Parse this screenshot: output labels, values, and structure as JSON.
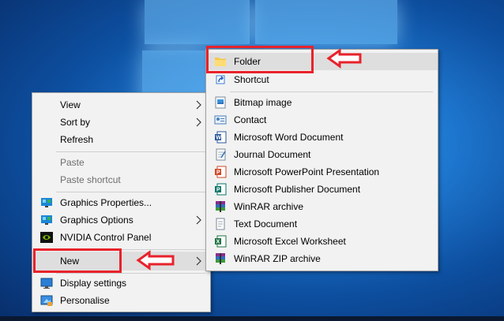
{
  "context_menu": {
    "items": [
      {
        "label": "View"
      },
      {
        "label": "Sort by"
      },
      {
        "label": "Refresh"
      },
      {
        "label": "Paste"
      },
      {
        "label": "Paste shortcut"
      },
      {
        "label": "Graphics Properties..."
      },
      {
        "label": "Graphics Options"
      },
      {
        "label": "NVIDIA Control Panel"
      },
      {
        "label": "New"
      },
      {
        "label": "Display settings"
      },
      {
        "label": "Personalise"
      }
    ]
  },
  "new_submenu": {
    "items": [
      {
        "label": "Folder"
      },
      {
        "label": "Shortcut"
      },
      {
        "label": "Bitmap image"
      },
      {
        "label": "Contact"
      },
      {
        "label": "Microsoft Word Document"
      },
      {
        "label": "Journal Document"
      },
      {
        "label": "Microsoft PowerPoint Presentation"
      },
      {
        "label": "Microsoft Publisher Document"
      },
      {
        "label": "WinRAR archive"
      },
      {
        "label": "Text Document"
      },
      {
        "label": "Microsoft Excel Worksheet"
      },
      {
        "label": "WinRAR ZIP archive"
      }
    ]
  },
  "icons": {
    "folder": "folder-icon",
    "shortcut": "shortcut-arrow-icon",
    "bitmap": "bitmap-image-icon",
    "contact": "contact-card-icon",
    "word": "word-document-icon",
    "journal": "journal-document-icon",
    "powerpoint": "powerpoint-icon",
    "publisher": "publisher-icon",
    "winrar": "winrar-archive-icon",
    "text": "text-document-icon",
    "excel": "excel-worksheet-icon",
    "graphics": "intel-graphics-icon",
    "nvidia": "nvidia-icon",
    "display": "display-monitor-icon",
    "personalise": "personalise-icon"
  },
  "colors": {
    "annotation_red": "#e8222b",
    "menu_bg": "#f2f2f2",
    "hover_bg": "#dedede",
    "desktop_blue": "#1f79d1"
  }
}
